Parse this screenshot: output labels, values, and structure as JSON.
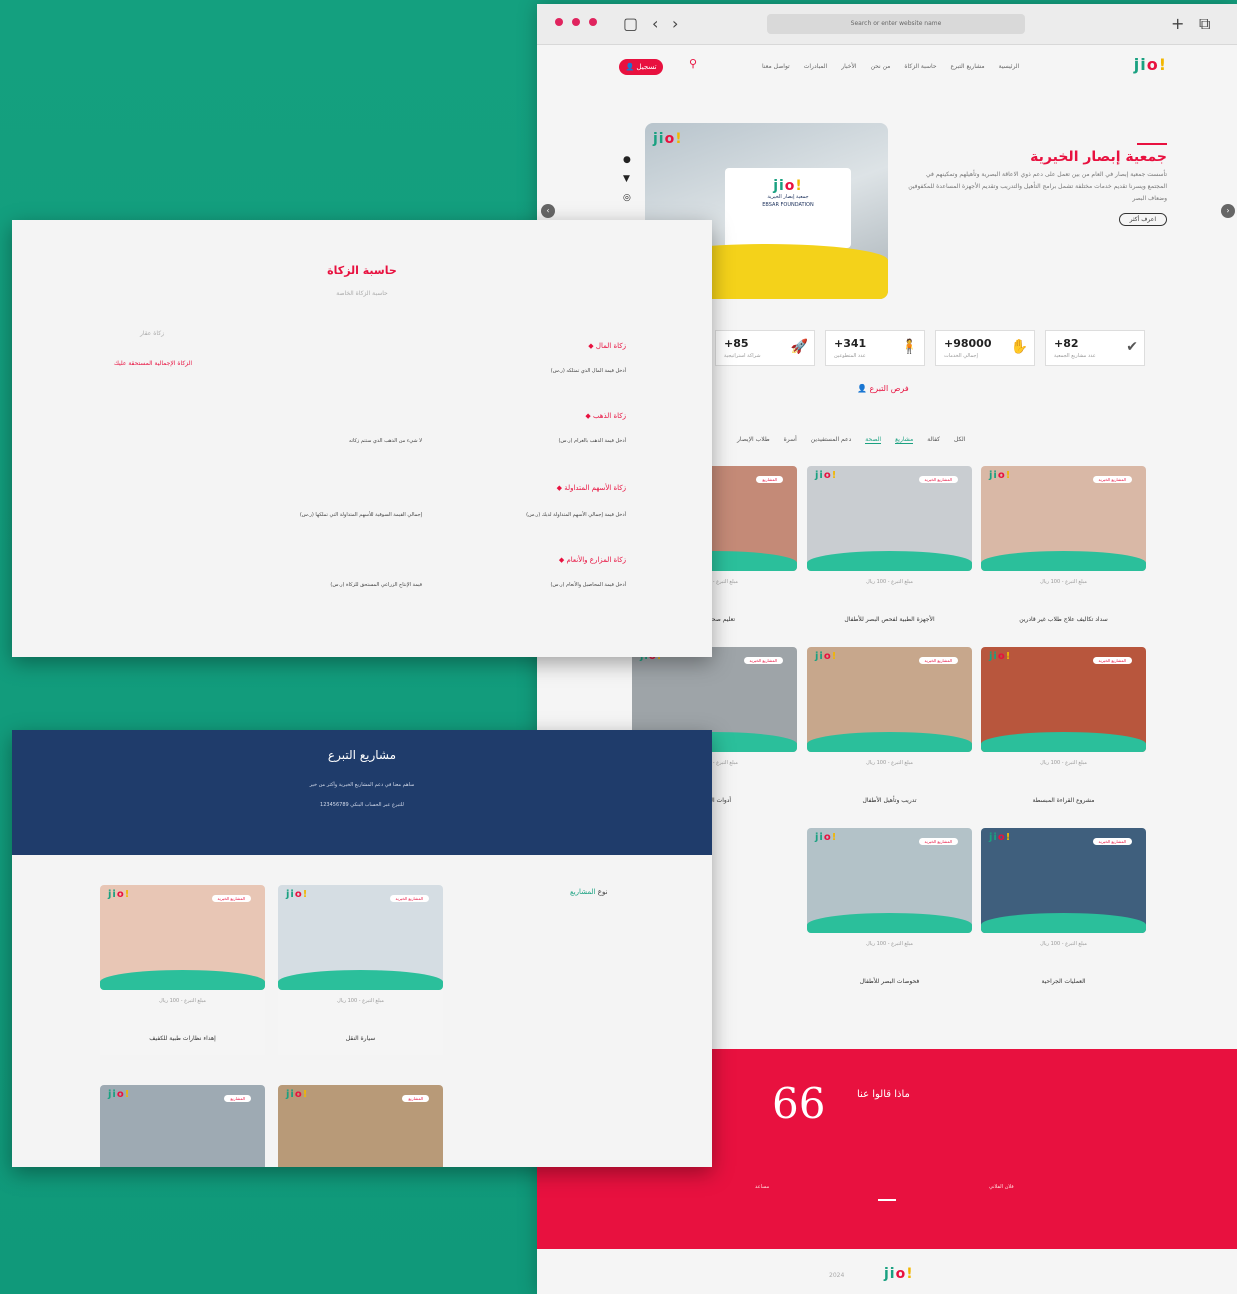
{
  "browser": {
    "url": "Search or enter website name",
    "nav": {
      "login": "تسجيل",
      "links": [
        "الرئيسية",
        "مشاريع التبرع",
        "حاسبة الزكاة",
        "من نحن",
        "الأخبار",
        "المبادرات",
        "تواصل معنا"
      ]
    },
    "logo": {
      "p1": "ji",
      "p2": "o",
      "p3": "!"
    },
    "hero": {
      "title": "جمعية إبصار الخيرية",
      "desc": "تأسست جمعية إبصار في العام من بين تعمل على دعم ذوي الاعاقة البصرية وتأهيلهم وتمكينهم في المجتمع ويسرنا تقديم خدمات مختلفة تشمل برامج التأهيل والتدريب وتقديم الأجهزة المساعدة للمكفوفين وضعاف البصر",
      "more": "اعرف أكثر",
      "sign_en": "EBSAR FOUNDATION",
      "sign_ar": "جمعية إبصار الخيرية"
    },
    "stats": [
      {
        "value": "+85",
        "label": "شراكة استراتيجية",
        "icon": "rocket-icon",
        "glyph": "🚀"
      },
      {
        "value": "+341",
        "label": "عدد المتطوعين",
        "icon": "person-icon",
        "glyph": "🧍"
      },
      {
        "value": "+98000",
        "label": "إجمالي الخدمات",
        "icon": "hand-icon",
        "glyph": "✋"
      },
      {
        "value": "+82",
        "label": "عدد مشاريع الجمعية",
        "icon": "check-circle-icon",
        "glyph": "✔"
      }
    ],
    "section_title": "فرص التبرع",
    "tabs": [
      "الكل",
      "كفالة",
      "مشاريع",
      "الصحة",
      "دعم المستفيدين",
      "أسرة",
      "طلاب الإبصار"
    ],
    "cards": [
      {
        "title": "سداد تكاليف علاج طلاب غير قادرين",
        "meta": "مبلغ التبرع - 100 ريال",
        "badge": "المشاريع الخيرية",
        "img": "#d9b8a6"
      },
      {
        "title": "الأجهزة الطبية لفحص البصر للأطفال",
        "meta": "مبلغ التبرع - 100 ريال",
        "badge": "المشاريع الخيرية",
        "img": "#c9cdd1"
      },
      {
        "title": "تعليم صحة العين",
        "meta": "مبلغ التبرع - 100 ريال",
        "badge": "المشاريع",
        "img": "#c48a77"
      },
      {
        "title": "مشروع القراءة المبسطة",
        "meta": "مبلغ التبرع - 100 ريال",
        "badge": "المشاريع الخيرية",
        "img": "#b8563d"
      },
      {
        "title": "تدريب وتأهيل الأطفال",
        "meta": "مبلغ التبرع - 100 ريال",
        "badge": "المشاريع الخيرية",
        "img": "#c7a78c"
      },
      {
        "title": "أدوات الحركة",
        "meta": "مبلغ التبرع - 100 ريال",
        "badge": "المشاريع الخيرية",
        "img": "#9ea4a8"
      },
      {
        "title": "العمليات الجراحية",
        "meta": "مبلغ التبرع - 100 ريال",
        "badge": "المشاريع الخيرية",
        "img": "#3f5f7d"
      },
      {
        "title": "فحوصات البصر للأطفال",
        "meta": "مبلغ التبرع - 100 ريال",
        "badge": "المشاريع الخيرية",
        "img": "#b3c2c8"
      }
    ],
    "testimonial": {
      "title": "ماذا قالوا عنا",
      "quote_mark": "66",
      "side1": "مساعد",
      "side2": "فلان الفلاني"
    },
    "footer_small": "2024"
  },
  "zakat": {
    "title": "حاسبة الزكاة",
    "subtitle": "حاسبة الزكاة الخاصة",
    "left_top": "زكاة عقار",
    "left_link": "الزكاة الإجمالية المستحقة عليك",
    "items": [
      {
        "head": "زكاة المال",
        "text1": "أدخل قيمة المال الذي تمتلكه (ر.س)",
        "text2": ""
      },
      {
        "head": "زكاة الذهب",
        "text1": "أدخل قيمة الذهب بالغرام (ر.س)",
        "text2": "لا شيء من الذهب الذي ستتم زكاته"
      },
      {
        "head": "زكاة الأسهم المتداولة",
        "text1": "أدخل قيمة إجمالي الأسهم المتداولة لديك (ر.س)",
        "text2": "إجمالي القيمة السوقية للأسهم المتداولة التي تملكها (ر.س)"
      },
      {
        "head": "زكاة المزارع والأنعام",
        "text1": "أدخل قيمة المحاصيل والأنعام (ر.س)",
        "text2": "قيمة الإنتاج الزراعي المستحق للزكاة (ر.س)"
      }
    ]
  },
  "projects": {
    "title": "مشاريع التبرع",
    "line1": "ساهم معنا في دعم المشاريع الخيرية وأكثر من خير",
    "line2": "للتبرع عبر الحساب البنكي 123456789",
    "filter_label": "نوع",
    "filter_value": "المشاريع",
    "cards": [
      {
        "title": "إهداء نظارات طبية للكفيف",
        "meta": "مبلغ التبرع - 100 ريال",
        "badge": "المشاريع الخيرية",
        "img": "#e8c6b5"
      },
      {
        "title": "سيارة النقل",
        "meta": "مبلغ التبرع - 100 ريال",
        "badge": "المشاريع الخيرية",
        "img": "#d5dde3"
      },
      {
        "title": "",
        "meta": "",
        "badge": "المشاريع",
        "img": "#9eaab3"
      },
      {
        "title": "",
        "meta": "",
        "badge": "المشاريع",
        "img": "#b89a78"
      }
    ]
  },
  "colors": {
    "accent": "#e8113f",
    "teal": "#1aa181",
    "navy": "#1f3c6b",
    "yellow": "#f2b600"
  }
}
